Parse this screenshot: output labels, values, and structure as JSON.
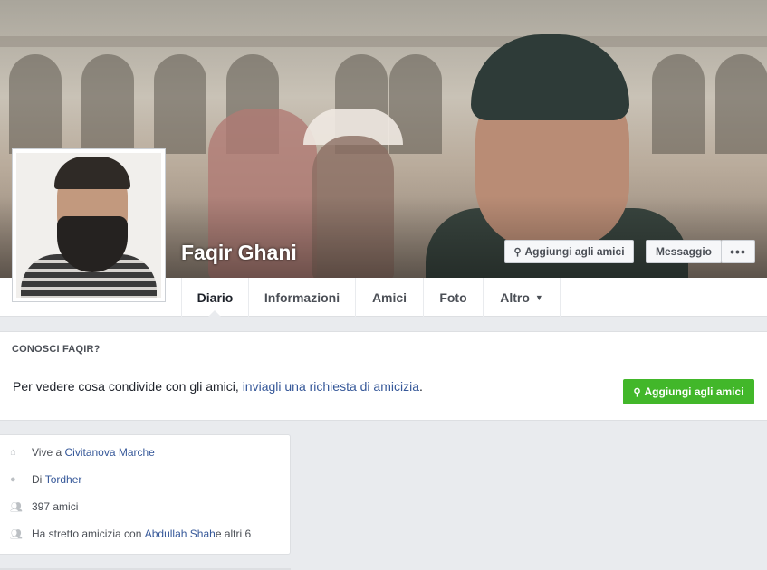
{
  "profile": {
    "name": "Faqir Ghani"
  },
  "actions": {
    "add_friend_label": "Aggiungi agli amici",
    "message_label": "Messaggio",
    "more_label": "•••",
    "add_icon": "add-friend-icon"
  },
  "nav": {
    "tabs": [
      {
        "label": "Diario"
      },
      {
        "label": "Informazioni"
      },
      {
        "label": "Amici"
      },
      {
        "label": "Foto"
      },
      {
        "label": "Altro"
      }
    ],
    "active": "Diario"
  },
  "know": {
    "title": "CONOSCI FAQIR?",
    "text_prefix": "Per vedere cosa condivide con gli amici, ",
    "link_text": "inviagli una richiesta di amicizia",
    "text_suffix": ".",
    "button_label": "Aggiungi agli amici"
  },
  "intro": {
    "lives_prefix": "Vive a ",
    "lives_place": "Civitanova Marche",
    "from_prefix": "Di ",
    "from_place": "Tordher",
    "friends_count": "397 amici",
    "friends_with_prefix": "Ha stretto amicizia con ",
    "friends_with_name": "Abdullah Shah",
    "friends_with_suffix": " e altri 6"
  },
  "colors": {
    "link": "#365899",
    "green_button": "#42b72a",
    "background": "#e9ebee"
  }
}
